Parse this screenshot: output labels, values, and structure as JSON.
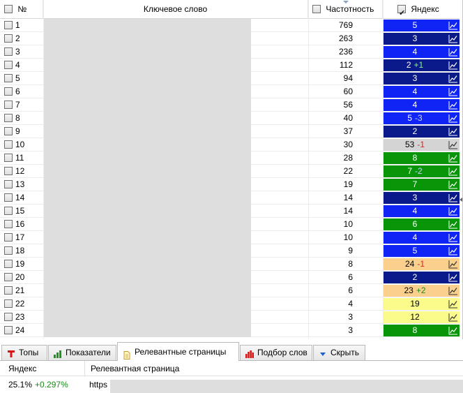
{
  "colors": {
    "rank_bg": {
      "navy": "#0b1a8a",
      "blue": "#0f24f5",
      "green": "#089608",
      "gray": "#d4d4d4",
      "orange": "#fbd08c",
      "yellow": "#fbfb8c"
    },
    "delta_pos": "#1b8a1b",
    "delta_neg": "#e02020"
  },
  "header": {
    "num_label": "№",
    "keyword_label": "Ключевое слово",
    "frequency_label": "Частотность",
    "yandex_label": "Яндекс",
    "yandex_checked": true
  },
  "rows": [
    {
      "num": "1",
      "freq": "769",
      "rank": "5",
      "delta": "",
      "bg": "blue"
    },
    {
      "num": "2",
      "freq": "263",
      "rank": "3",
      "delta": "",
      "bg": "navy"
    },
    {
      "num": "3",
      "freq": "236",
      "rank": "4",
      "delta": "",
      "bg": "blue"
    },
    {
      "num": "4",
      "freq": "112",
      "rank": "2",
      "delta": "+1",
      "bg": "navy"
    },
    {
      "num": "5",
      "freq": "94",
      "rank": "3",
      "delta": "",
      "bg": "navy"
    },
    {
      "num": "6",
      "freq": "60",
      "rank": "4",
      "delta": "",
      "bg": "blue"
    },
    {
      "num": "7",
      "freq": "56",
      "rank": "4",
      "delta": "",
      "bg": "blue"
    },
    {
      "num": "8",
      "freq": "40",
      "rank": "5",
      "delta": "-3",
      "bg": "blue"
    },
    {
      "num": "9",
      "freq": "37",
      "rank": "2",
      "delta": "",
      "bg": "navy"
    },
    {
      "num": "10",
      "freq": "30",
      "rank": "53",
      "delta": "-1",
      "bg": "gray"
    },
    {
      "num": "11",
      "freq": "28",
      "rank": "8",
      "delta": "",
      "bg": "green"
    },
    {
      "num": "12",
      "freq": "22",
      "rank": "7",
      "delta": "-2",
      "bg": "green"
    },
    {
      "num": "13",
      "freq": "19",
      "rank": "7",
      "delta": "",
      "bg": "green"
    },
    {
      "num": "14",
      "freq": "14",
      "rank": "3",
      "delta": "",
      "bg": "navy"
    },
    {
      "num": "15",
      "freq": "14",
      "rank": "4",
      "delta": "",
      "bg": "blue"
    },
    {
      "num": "16",
      "freq": "10",
      "rank": "6",
      "delta": "",
      "bg": "green"
    },
    {
      "num": "17",
      "freq": "10",
      "rank": "4",
      "delta": "",
      "bg": "blue"
    },
    {
      "num": "18",
      "freq": "9",
      "rank": "5",
      "delta": "",
      "bg": "blue"
    },
    {
      "num": "19",
      "freq": "8",
      "rank": "24",
      "delta": "-1",
      "bg": "orange"
    },
    {
      "num": "20",
      "freq": "6",
      "rank": "2",
      "delta": "",
      "bg": "navy"
    },
    {
      "num": "21",
      "freq": "6",
      "rank": "23",
      "delta": "+2",
      "bg": "orange"
    },
    {
      "num": "22",
      "freq": "4",
      "rank": "19",
      "delta": "",
      "bg": "yellow"
    },
    {
      "num": "23",
      "freq": "3",
      "rank": "12",
      "delta": "",
      "bg": "yellow"
    },
    {
      "num": "24",
      "freq": "3",
      "rank": "8",
      "delta": "",
      "bg": "green"
    }
  ],
  "tabs": [
    {
      "label": "Топы",
      "icon": "tops-icon"
    },
    {
      "label": "Показатели",
      "icon": "bar-chart-icon"
    },
    {
      "label": "Релевантные страницы",
      "icon": "document-icon",
      "active": true
    },
    {
      "label": "Подбор слов",
      "icon": "red-bars-icon"
    },
    {
      "label": "Скрыть",
      "icon": "hide-arrow-icon"
    }
  ],
  "bottom": {
    "col_yandex": "Яндекс",
    "col_page": "Релевантная страница",
    "value": "25.1%",
    "change": "+0.297%",
    "page_prefix": "https"
  }
}
